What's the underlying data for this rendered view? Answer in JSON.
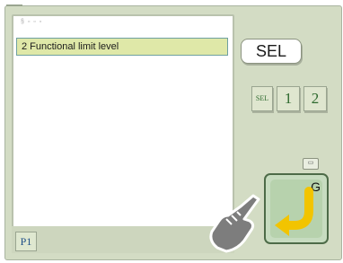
{
  "list": {
    "header": "§ ▫ ▫ ▫",
    "selected_item": "2 Functional limit level"
  },
  "buttons": {
    "sel_label": "SEL",
    "s1_label": "SEL",
    "one_label": "1",
    "two_label": "2",
    "g_label": "G",
    "tiny_label": "▭"
  },
  "footer": {
    "page_label": "P1"
  },
  "icons": {
    "return": "return-arrow-icon",
    "hand": "pointing-hand-icon"
  },
  "colors": {
    "panel": "#d3dcc4",
    "selection": "#dfe8a8",
    "arrow": "#f2c400",
    "g_button": "#b7d2ad"
  }
}
